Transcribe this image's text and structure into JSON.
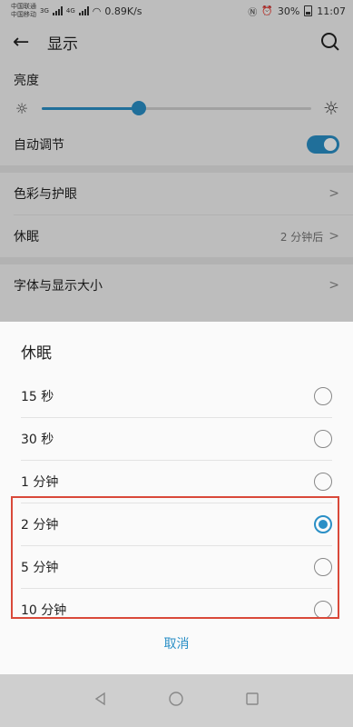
{
  "status_bar": {
    "carrier1": "中国联通",
    "carrier2": "中国移动",
    "net1": "3G",
    "net2": "4G",
    "speed": "0.89K/s",
    "battery": "30%",
    "time": "11:07"
  },
  "app_bar": {
    "title": "显示"
  },
  "settings": {
    "brightness_label": "亮度",
    "brightness_level": 0.36,
    "auto_adjust_label": "自动调节",
    "auto_adjust_on": true,
    "color_label": "色彩与护眼",
    "sleep_label": "休眠",
    "sleep_value": "2 分钟后",
    "font_label": "字体与显示大小"
  },
  "dialog": {
    "title": "休眠",
    "options": [
      {
        "label": "15 秒",
        "selected": false
      },
      {
        "label": "30 秒",
        "selected": false
      },
      {
        "label": "1 分钟",
        "selected": false
      },
      {
        "label": "2 分钟",
        "selected": true
      },
      {
        "label": "5 分钟",
        "selected": false
      },
      {
        "label": "10 分钟",
        "selected": false
      }
    ],
    "cancel_label": "取消"
  },
  "colors": {
    "accent": "#2a8fc6",
    "highlight": "#d9493a"
  },
  "icons": {
    "back": "arrow-left-icon",
    "search": "search-icon",
    "sun_small": "sun-small-icon",
    "sun_large": "sun-large-icon",
    "chevron": "chevron-right-icon",
    "nav_back": "triangle-back-icon",
    "nav_home": "circle-home-icon",
    "nav_recent": "square-recent-icon"
  }
}
